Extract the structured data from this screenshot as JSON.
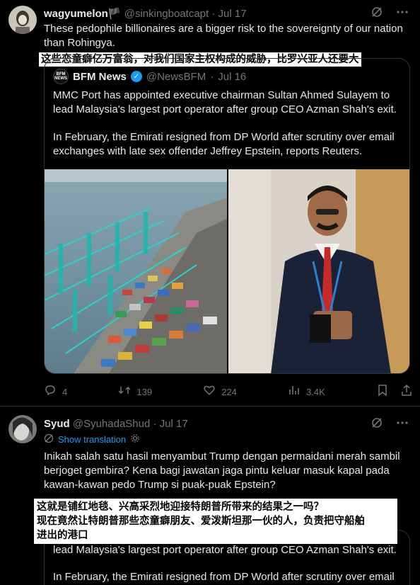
{
  "post1": {
    "display_name": "wagyumelon",
    "flag": "🏴",
    "handle": "@sinkingboatcapt",
    "date": "Jul 17",
    "text": "These pedophile billionaires are a bigger risk to the sovereignty of our nation than Rohingya.",
    "translation_overlay": "这些恋童癖亿万富翁，对我们国家主权构成的威胁，比罗兴亚人还要大",
    "quote": {
      "avatar_text_1": "BFM",
      "avatar_text_2": "NEWS",
      "name": "BFM News",
      "handle": "@NewsBFM",
      "date": "Jul 16",
      "para1": "MMC Port has appointed executive chairman Sultan Ahmed Sulayem to lead Malaysia's largest port operator after group CEO Azman Shah's exit.",
      "para2": "In February, the Emirati resigned from DP World after scrutiny over email exchanges with late sex offender Jeffrey Epstein, reports Reuters."
    },
    "actions": {
      "replies": "4",
      "reposts": "139",
      "likes": "224",
      "views": "3.4K"
    }
  },
  "post2": {
    "display_name": "Syud",
    "handle": "@SyuhadaShud",
    "date": "Jul 17",
    "show_translation": "Show translation",
    "text": "Inikah salah satu hasil menyambut Trump dengan permaidani merah sambil berjoget gembira? Kena bagi jawatan jaga pintu keluar masuk kapal pada kawan-kawan pedo Trump si puak-puak Epstein?",
    "translation_overlay_1": "这就是铺红地毯、兴高采烈地迎接特朗普所带来的结果之一吗？",
    "translation_overlay_2": "现在竟然让特朗普那些恋童癖朋友、爱泼斯坦那一伙的人，负责把守船舶",
    "translation_overlay_3": "进出的港口",
    "quote_para1_line2": "lead Malaysia's largest port operator after group CEO Azman Shah's exit.",
    "quote_para2_line1": "In February, the Emirati resigned from DP World after scrutiny over email"
  },
  "colors": {
    "accent": "#1d9bf0",
    "muted": "#71767b",
    "border": "#2f3336"
  }
}
